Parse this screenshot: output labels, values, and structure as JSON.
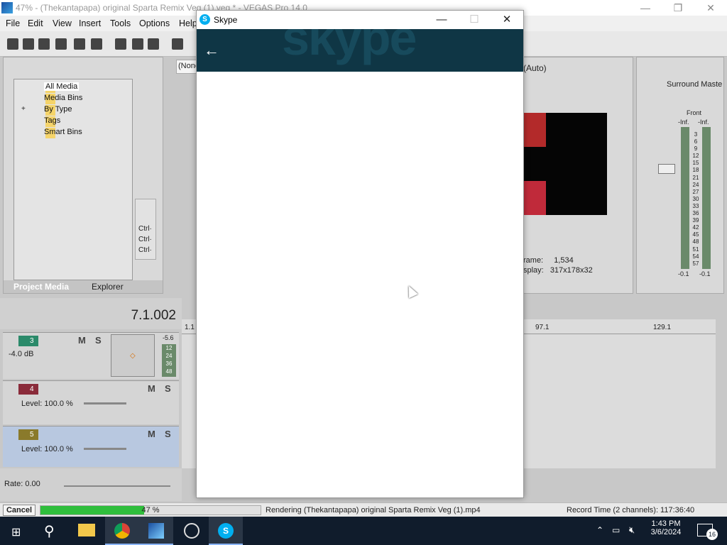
{
  "vegas": {
    "title": "47% - (Thekantapapa) original Sparta Remix Veg (1).veg * - VEGAS Pro 14.0",
    "menu": [
      "File",
      "Edit",
      "View",
      "Insert",
      "Tools",
      "Options",
      "Help"
    ],
    "preview_dropdown": "(None",
    "preview_quality": "(Auto)",
    "project_media_tree": [
      "All Media",
      "Media Bins",
      "By Type",
      "Tags",
      "Smart Bins"
    ],
    "tabs": {
      "project_media": "Project Media",
      "explorer": "Explorer"
    },
    "ctrl_labels": [
      "Ctrl·",
      "Ctrl·",
      "Ctrl·"
    ],
    "timecode": "7.1.002",
    "ruler": [
      "1.1",
      "97.1",
      "129.1"
    ],
    "frame_label": "rame:",
    "frame_value": "1,534",
    "display_label": "splay:",
    "display_value": "317x178x32",
    "surround_master": "Surround Maste",
    "front_label": "Front",
    "inf_left": "-Inf.",
    "inf_right": "-Inf.",
    "meter_scale": [
      "3",
      "6",
      "9",
      "12",
      "15",
      "18",
      "21",
      "24",
      "27",
      "30",
      "33",
      "36",
      "39",
      "42",
      "45",
      "48",
      "51",
      "54",
      "57"
    ],
    "meter_bottom_left": "-0.1",
    "meter_bottom_right": "-0.1",
    "tracks": [
      {
        "num": "3",
        "info": "-4.0 dB",
        "color": "#2b8a6a",
        "pan_value": "-5.6",
        "db_scale": [
          "12",
          "24",
          "36",
          "48"
        ]
      },
      {
        "num": "4",
        "info": "Level: 100.0 %",
        "color": "#8a2b3a"
      },
      {
        "num": "5",
        "info": "Level: 100.0 %",
        "color": "#8a7a2b"
      }
    ],
    "rate": "Rate: 0.00",
    "status": {
      "cancel": "Cancel",
      "progress_text": "47 %",
      "progress": 0.47,
      "rendering": "Rendering (Thekantapapa) original Sparta Remix Veg (1).mp4",
      "record_time": "Record Time (2 channels): 117:36:40"
    }
  },
  "skype": {
    "title": "Skype",
    "icon_letter": "S",
    "watermark": "skype",
    "header_color": "#0f3645"
  },
  "taskbar": {
    "time": "1:43 PM",
    "date": "3/6/2024",
    "notifications": "16"
  }
}
